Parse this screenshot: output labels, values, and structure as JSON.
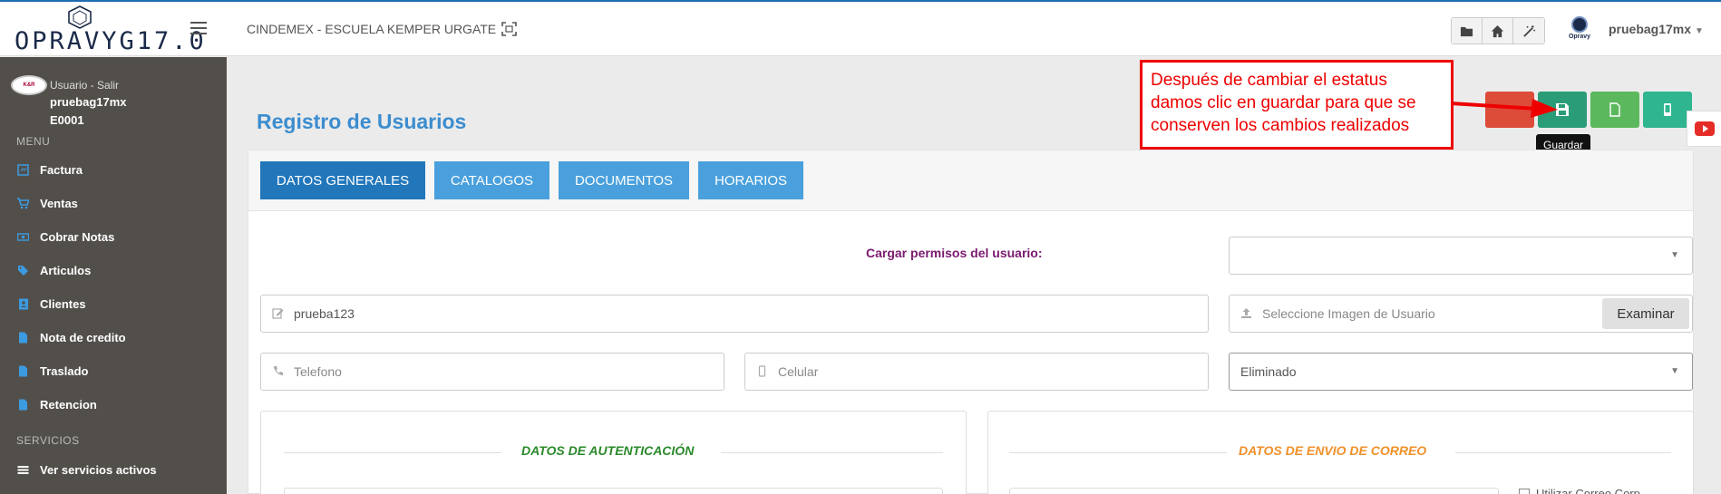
{
  "topbar": {
    "logo_text": "OPRAVYG17.0",
    "company": "CINDEMEX - ESCUELA KEMPER URGATE",
    "small_logo_text": "Opravy",
    "user": "pruebag17mx",
    "icons": [
      "folder-icon",
      "home-icon",
      "magic-wand-icon"
    ]
  },
  "sidebar": {
    "avatar_text": "K&R",
    "user_link": "Usuario - Salir",
    "username": "pruebag17mx",
    "code": "E0001",
    "menu_header": "MENU",
    "items": [
      {
        "label": "Factura",
        "icon": "invoice-icon"
      },
      {
        "label": "Ventas",
        "icon": "cart-icon"
      },
      {
        "label": "Cobrar Notas",
        "icon": "money-icon"
      },
      {
        "label": "Articulos",
        "icon": "tags-icon"
      },
      {
        "label": "Clientes",
        "icon": "address-book-icon"
      },
      {
        "label": "Nota de credito",
        "icon": "file-icon"
      },
      {
        "label": "Traslado",
        "icon": "file-icon"
      },
      {
        "label": "Retencion",
        "icon": "file-icon"
      }
    ],
    "services_header": "SERVICIOS",
    "services_items": [
      {
        "label": "Ver servicios activos",
        "icon": "list-icon"
      }
    ]
  },
  "main": {
    "title": "Registro de Usuarios",
    "annotation": "Después de cambiar el estatus damos clic en guardar para que se conserven los cambios realizados",
    "tooltip": "Guardar",
    "colors": {
      "danger": "#dd4b39",
      "save": "#2a9d78",
      "new": "#5cb85c",
      "extra": "#2fb58f",
      "tab_active": "#2277bb",
      "tab": "#4aa0dc"
    },
    "tabs": [
      {
        "label": "DATOS GENERALES",
        "active": true
      },
      {
        "label": "CATALOGOS",
        "active": false
      },
      {
        "label": "DOCUMENTOS",
        "active": false
      },
      {
        "label": "HORARIOS",
        "active": false
      }
    ],
    "perm_label": "Cargar permisos del usuario:",
    "perm_select_value": "",
    "username_value": "prueba123",
    "image_placeholder": "Seleccione Imagen de Usuario",
    "examinar_label": "Examinar",
    "telefono_placeholder": "Telefono",
    "celular_placeholder": "Celular",
    "status_value": "Eliminado",
    "auth_title": "DATOS DE AUTENTICACIÓN",
    "mail_title": "DATOS DE ENVIO DE CORREO",
    "mail_checkbox_label": "Utilizar Correo Corp"
  }
}
